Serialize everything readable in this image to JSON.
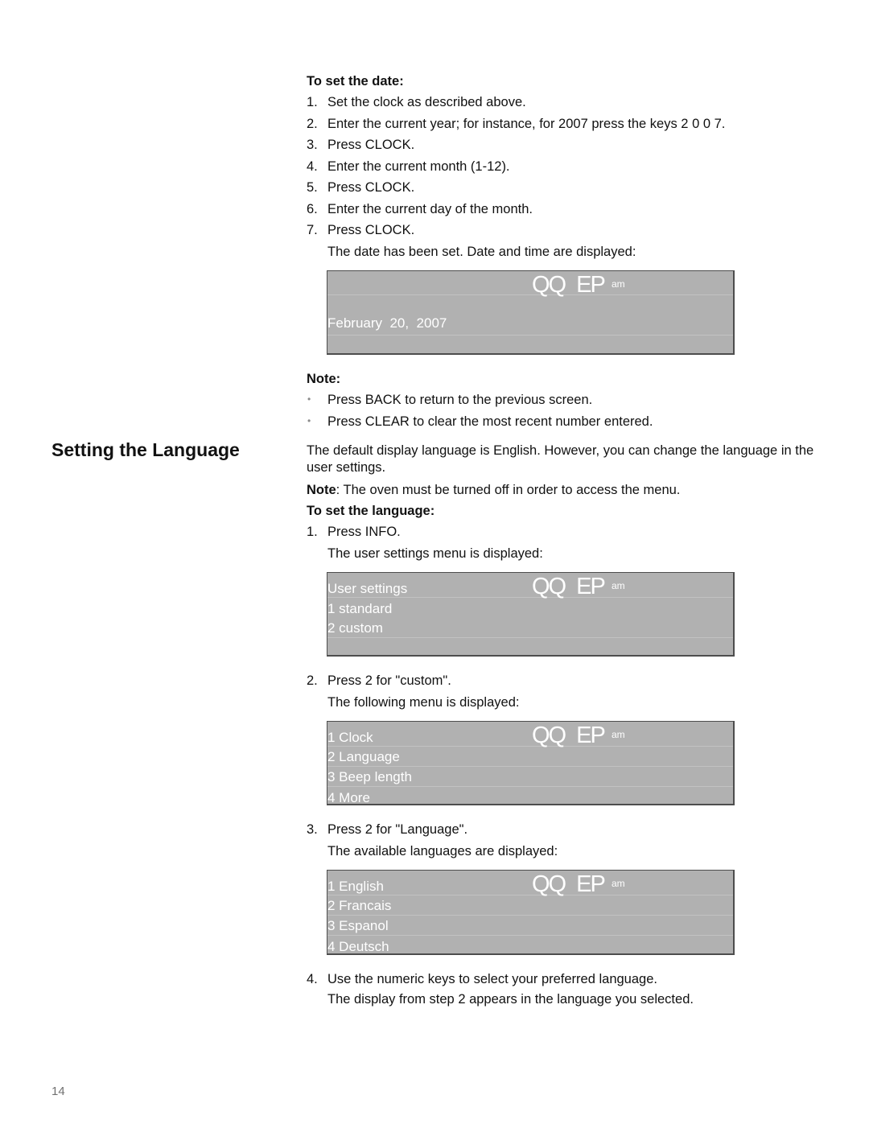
{
  "date_section": {
    "heading": "To set the date:",
    "steps": [
      {
        "num": "1.",
        "text": "Set the clock as described above."
      },
      {
        "num": "2.",
        "text": "Enter the current year; for instance, for 2007 press the keys 2 0 0 7."
      },
      {
        "num": "3.",
        "text": "Press CLOCK."
      },
      {
        "num": "4.",
        "text": "Enter the current month (1-12)."
      },
      {
        "num": "5.",
        "text": "Press CLOCK."
      },
      {
        "num": "6.",
        "text": "Enter the current day of the month."
      },
      {
        "num": "7.",
        "text": "Press CLOCK."
      }
    ],
    "result_text": "The date has been set. Date and time are displayed:",
    "display": {
      "clock": "QQ EP",
      "clock_left": "QQ",
      "clock_right": "EP",
      "ampm": "am",
      "rows": [
        "",
        "February  20,  2007",
        "",
        ""
      ]
    }
  },
  "note_block": {
    "label": "Note:",
    "bullets": [
      "Press BACK to return to the previous screen.",
      "Press CLEAR to clear the most recent number entered."
    ],
    "bullet_icon": "•"
  },
  "language_section": {
    "title": "Setting the Language",
    "intro": "The default display language is English. However, you can change the language in the user settings.",
    "note_label": "Note",
    "note_text": ": The oven must be turned off in order to access the menu.",
    "heading": "To set the language:",
    "step1": {
      "num": "1.",
      "text": "Press INFO.",
      "result": "The user settings menu is displayed:"
    },
    "display1": {
      "clock_left": "QQ",
      "clock_right": "EP",
      "ampm": "am",
      "rows": [
        "User settings",
        "1 standard",
        "2 custom",
        ""
      ]
    },
    "step2": {
      "num": "2.",
      "text": "Press 2 for \"custom\".",
      "result": "The following menu is displayed:"
    },
    "display2": {
      "clock_left": "QQ",
      "clock_right": "EP",
      "ampm": "am",
      "rows": [
        "1 Clock",
        "2 Language",
        "3 Beep length",
        "4 More"
      ]
    },
    "step3": {
      "num": "3.",
      "text": "Press 2 for \"Language\".",
      "result": "The available languages are displayed:"
    },
    "display3": {
      "clock_left": "QQ",
      "clock_right": "EP",
      "ampm": "am",
      "rows": [
        "1 English",
        "2 Francais",
        "3 Espanol",
        "4 Deutsch"
      ]
    },
    "step4": {
      "num": "4.",
      "text": "Use the numeric keys to select your preferred language.",
      "result": "The display from step 2 appears in the language you selected."
    }
  },
  "footer": {
    "page_number": "14"
  }
}
